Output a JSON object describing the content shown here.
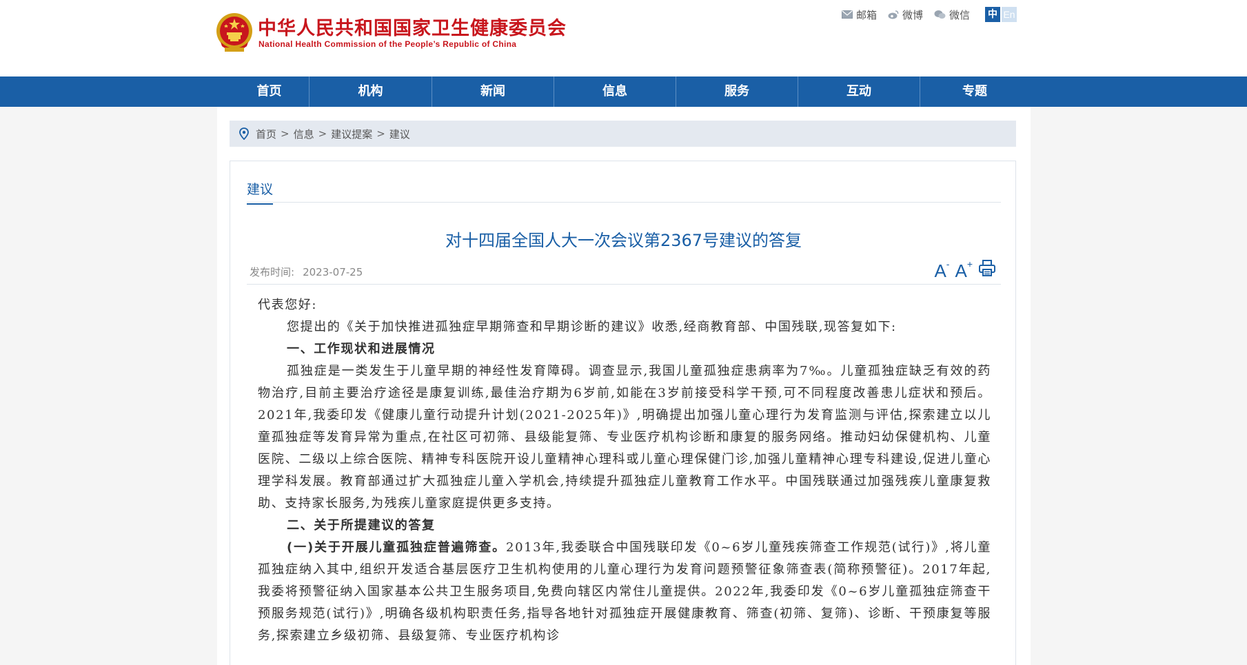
{
  "header": {
    "site_name": "中华人民共和国国家卫生健康委员会",
    "site_name_en": "National Health Commission of the People’s Republic of China",
    "quick_links": [
      {
        "label": "邮箱",
        "icon": "mail-icon"
      },
      {
        "label": "微博",
        "icon": "weibo-icon"
      },
      {
        "label": "微信",
        "icon": "wechat-icon"
      }
    ],
    "lang_zh": "中",
    "lang_en": "En"
  },
  "nav": {
    "items": [
      "首页",
      "机构",
      "新闻",
      "信息",
      "服务",
      "互动",
      "专题"
    ]
  },
  "breadcrumb": {
    "items": [
      "首页",
      "信息",
      "建议提案",
      "建议"
    ],
    "sep": ">"
  },
  "section": {
    "title": "建议"
  },
  "article": {
    "title": "对十四届全国人大一次会议第2367号建议的答复",
    "date_label": "发布时间:",
    "date": "2023-07-25",
    "font_smaller": "A",
    "font_smaller_sup": "-",
    "font_larger": "A",
    "font_larger_sup": "+",
    "greeting": "代表您好:",
    "intro": "您提出的《关于加快推进孤独症早期筛查和早期诊断的建议》收悉,经商教育部、中国残联,现答复如下:",
    "heading1": "一、工作现状和进展情况",
    "para1": "孤独症是一类发生于儿童早期的神经性发育障碍。调查显示,我国儿童孤独症患病率为7‰。儿童孤独症缺乏有效的药物治疗,目前主要治疗途径是康复训练,最佳治疗期为6岁前,如能在3岁前接受科学干预,可不同程度改善患儿症状和预后。2021年,我委印发《健康儿童行动提升计划(2021-2025年)》,明确提出加强儿童心理行为发育监测与评估,探索建立以儿童孤独症等发育异常为重点,在社区可初筛、县级能复筛、专业医疗机构诊断和康复的服务网络。推动妇幼保健机构、儿童医院、二级以上综合医院、精神专科医院开设儿童精神心理科或儿童心理保健门诊,加强儿童精神心理专科建设,促进儿童心理学科发展。教育部通过扩大孤独症儿童入学机会,持续提升孤独症儿童教育工作水平。中国残联通过加强残疾儿童康复救助、支持家长服务,为残疾儿童家庭提供更多支持。",
    "heading2": "二、关于所提建议的答复",
    "para2_bold": "(一)关于开展儿童孤独症普遍筛查。",
    "para2": "2013年,我委联合中国残联印发《0~6岁儿童残疾筛查工作规范(试行)》,将儿童孤独症纳入其中,组织开发适合基层医疗卫生机构使用的儿童心理行为发育问题预警征象筛查表(简称预警征)。2017年起,我委将预警征纳入国家基本公共卫生服务项目,免费向辖区内常住儿童提供。2022年,我委印发《0~6岁儿童孤独症筛查干预服务规范(试行)》,明确各级机构职责任务,指导各地针对孤独症开展健康教育、筛查(初筛、复筛)、诊断、干预康复等服务,探索建立乡级初筛、县级复筛、专业医疗机构诊"
  }
}
